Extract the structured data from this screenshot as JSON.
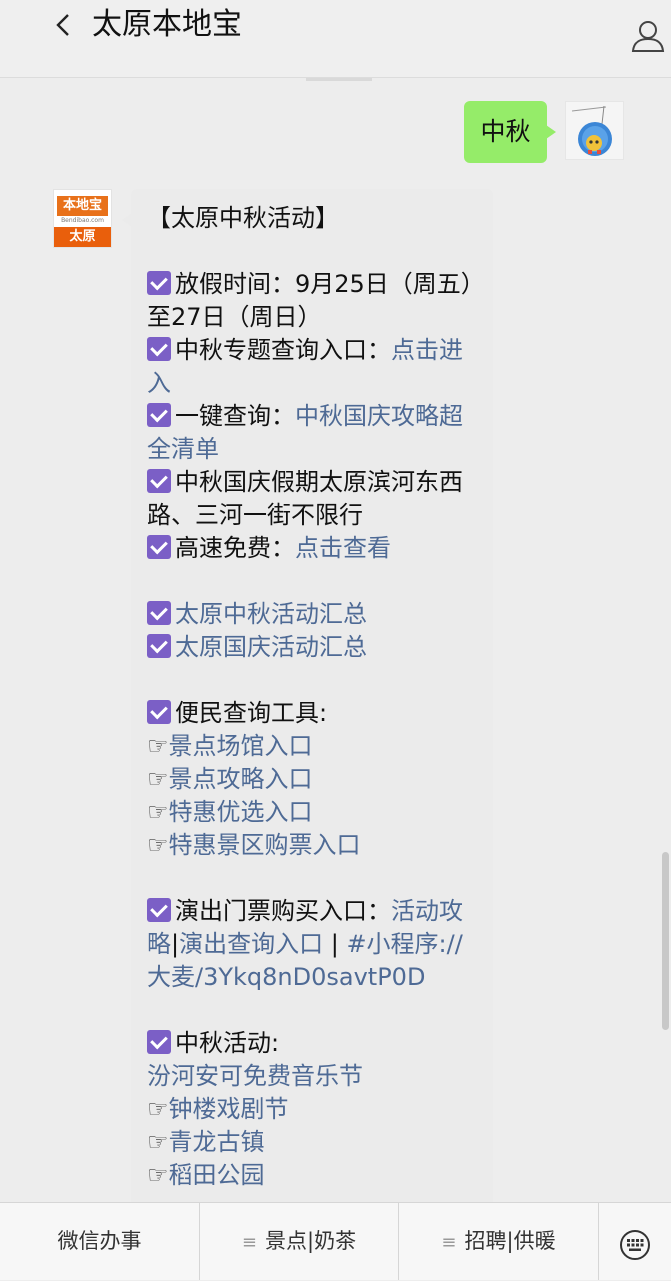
{
  "header": {
    "title": "太原本地宝",
    "back_icon": "chevron-left-icon",
    "user_icon": "user-profile-icon"
  },
  "messages": {
    "outgoing": {
      "text": "中秋"
    },
    "bot_avatar": {
      "top_text": "本地宝",
      "url_text": "Bendibao.com",
      "bottom_text": "太原",
      "brand_color": "#e8711a"
    },
    "reply": {
      "title": "【太原中秋活动】",
      "holiday_label": "放假时间：9月25日（周五）至27日（周日）",
      "topic_label": "中秋专题查询入口：",
      "topic_link": "点击进入",
      "query_label": "一键查询：",
      "query_link": "中秋国庆攻略超全清单",
      "traffic_text": "中秋国庆假期太原滨河东西路、三河一街不限行",
      "highway_label": "高速免费：",
      "highway_link": "点击查看",
      "summary_mid_autumn": "太原中秋活动汇总",
      "summary_national_day": "太原国庆活动汇总",
      "tools_label": "便民查询工具:",
      "tools": [
        "景点场馆入口",
        "景点攻略入口",
        "特惠优选入口",
        "特惠景区购票入口"
      ],
      "tickets_label": "演出门票购买入口：",
      "tickets_link1": "活动攻略",
      "tickets_sep1": "|",
      "tickets_link2": "演出查询入口",
      "tickets_sep2": " | ",
      "tickets_link3": "#小程序://大麦/3Ykq8nD0savtP0D",
      "activities_label": "中秋活动:",
      "activity_first": "汾河安可免费音乐节",
      "activities": [
        "钟楼戏剧节",
        "青龙古镇",
        "稻田公园"
      ],
      "hand_glyph": "☞"
    }
  },
  "bottom_menu": {
    "items": [
      "微信办事",
      "景点|奶茶",
      "招聘|供暖"
    ],
    "menu_glyph": "≡",
    "keyboard_icon": "keyboard-icon"
  },
  "colors": {
    "outgoing_bubble": "#95ec69",
    "link": "#4e6a95",
    "checkbox": "#7b5fc6",
    "background": "#ededed"
  }
}
